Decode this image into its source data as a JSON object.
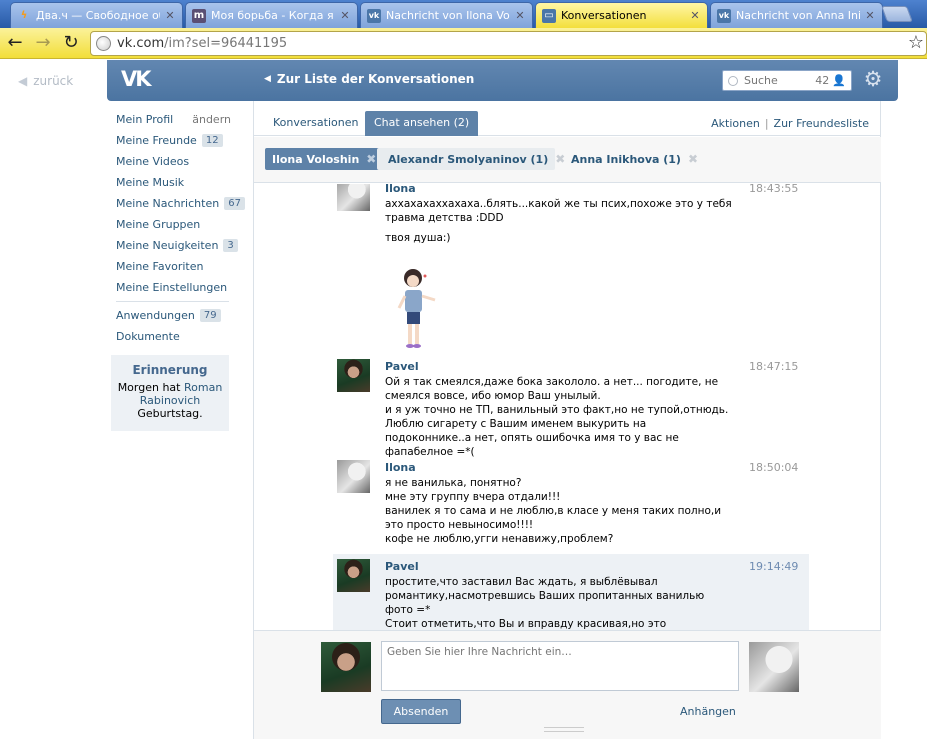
{
  "browser": {
    "tabs": [
      {
        "title": "Два.ч — Свободное общ",
        "icon": "bolt-icon",
        "active": false
      },
      {
        "title": "Моя борьба - Когда я ст",
        "icon": "m-icon",
        "active": false
      },
      {
        "title": "Nachricht von Ilona Volosh",
        "icon": "vk-icon",
        "active": false
      },
      {
        "title": "Konversationen",
        "icon": "chat-icon",
        "active": true
      },
      {
        "title": "Nachricht von Anna Inikho",
        "icon": "vk-icon",
        "active": false
      }
    ],
    "url": {
      "host": "vk.com",
      "path": "/im?sel=96441195"
    }
  },
  "page": {
    "back_label": "zurück",
    "header": {
      "logo": "VK",
      "back_to_list": "Zur Liste der Konversationen",
      "search_placeholder": "Suche",
      "search_count": "42"
    },
    "sidebar": {
      "items": [
        {
          "label": "Mein Profil",
          "extra": "ändern"
        },
        {
          "label": "Meine Freunde",
          "badge": "12"
        },
        {
          "label": "Meine Videos"
        },
        {
          "label": "Meine Musik"
        },
        {
          "label": "Meine Nachrichten",
          "badge": "67"
        },
        {
          "label": "Meine Gruppen"
        },
        {
          "label": "Meine Neuigkeiten",
          "badge": "3"
        },
        {
          "label": "Meine Favoriten"
        },
        {
          "label": "Meine Einstellungen"
        }
      ],
      "apps": [
        {
          "label": "Anwendungen",
          "badge": "79"
        },
        {
          "label": "Dokumente"
        }
      ],
      "reminder": {
        "title": "Erinnerung",
        "text_before": "Morgen hat",
        "name": "Roman Rabinovich",
        "text_after": "Geburtstag."
      }
    },
    "tabs": [
      {
        "label": "Konversationen",
        "active": false
      },
      {
        "label": "Chat ansehen (2)",
        "active": true
      }
    ],
    "actions": {
      "aktionen": "Aktionen",
      "sep": "|",
      "freunde": "Zur Freundesliste"
    },
    "chips": [
      {
        "label": "Ilona Voloshin",
        "selected": true
      },
      {
        "label": "Alexandr Smolyaninov (1)",
        "selected": false
      },
      {
        "label": "Anna Inikhova (1)",
        "selected": false
      }
    ],
    "messages": [
      {
        "author": "Ilona",
        "time": "18:43:55",
        "text": "аххахахаххахаха..блять...какой же ты псих,похоже это у тебя травма детства :DDD",
        "text2": "твоя душа:)",
        "has_sticker": true,
        "highlight": false
      },
      {
        "author": "Pavel",
        "time": "18:47:15",
        "text": "Ой я так смеялся,даже бока закололо. а нет... погодите, не смеялся вовсе, ибо юмор Ваш унылый.\nи я уж точно не ТП, ванильный это факт,но не тупой,отнюдь.\nЛюблю сигарету с Вашим именем выкурить на подоконнике..а нет, опять ошибочка имя то у вас не фапабелное =*(",
        "highlight": false
      },
      {
        "author": "Ilona",
        "time": "18:50:04",
        "text": "я не ванилька, понятно?\nмне эту группу вчера отдали!!!\nванилек я то сама и не люблю,в класе у меня таких полно,и это просто невыносимо!!!!\nкофе не люблю,угги ненавижу,проблем?",
        "highlight": false
      },
      {
        "author": "Pavel",
        "time": "19:14:49",
        "text": "простите,что заставил Вас ждать, я выблёвывал романтику,насмотревшись Ваших пропитанных ванилью фото =*\nСтоит отметить,что Вы и вправду красивая,но это единственный Ваш плюс =*(",
        "highlight": true
      }
    ],
    "compose": {
      "placeholder": "Geben Sie hier Ihre Nachricht ein…",
      "send_label": "Absenden",
      "attach_label": "Anhängen"
    }
  }
}
